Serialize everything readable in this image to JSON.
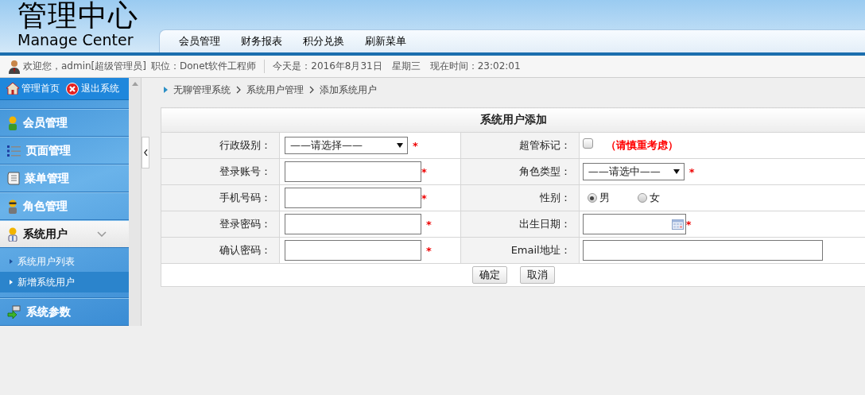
{
  "header": {
    "logo_title": "管理中心",
    "logo_subtitle": "Manage Center",
    "nav": [
      {
        "label": "会员管理"
      },
      {
        "label": "财务报表"
      },
      {
        "label": "积分兑换"
      },
      {
        "label": "刷新菜单"
      }
    ]
  },
  "info_bar": {
    "welcome": "欢迎您，admin[超级管理员]",
    "position": "职位：Donet软件工程师",
    "today": "今天是：2016年8月31日",
    "weekday": "星期三",
    "time": "现在时间：23:02:01"
  },
  "sidebar": {
    "top_links": [
      {
        "label": "管理首页",
        "kind": "home"
      },
      {
        "label": "退出系统",
        "kind": "exit"
      }
    ],
    "items": [
      {
        "label": "会员管理",
        "kind": "member",
        "expanded": false
      },
      {
        "label": "页面管理",
        "kind": "list",
        "expanded": false
      },
      {
        "label": "菜单管理",
        "kind": "doc",
        "expanded": false
      },
      {
        "label": "角色管理",
        "kind": "role",
        "expanded": false
      },
      {
        "label": "系统用户",
        "kind": "user",
        "expanded": true,
        "children": [
          {
            "label": "系统用户列表",
            "selected": false
          },
          {
            "label": "新增系统用户",
            "selected": true
          }
        ]
      },
      {
        "label": "系统参数",
        "kind": "param",
        "expanded": false
      }
    ]
  },
  "breadcrumb": [
    "无聊管理系统",
    "系统用户管理",
    "添加系统用户"
  ],
  "form": {
    "title": "系统用户添加",
    "rows": [
      [
        {
          "label": "行政级别：",
          "kind": "select",
          "value": "——请选择——",
          "mark": "*"
        },
        {
          "label": "超管标记：",
          "kind": "checkbox",
          "checked": false,
          "note": "（请慎重考虑）"
        }
      ],
      [
        {
          "label": "登录账号：",
          "kind": "text",
          "mark": "*"
        },
        {
          "label": "角色类型：",
          "kind": "select",
          "value": "——请选中——",
          "mark": "*"
        }
      ],
      [
        {
          "label": "手机号码：",
          "kind": "text",
          "mark": "*"
        },
        {
          "label": "性别：",
          "kind": "radio",
          "options": [
            {
              "label": "男",
              "selected": true
            },
            {
              "label": "女",
              "selected": false
            }
          ]
        }
      ],
      [
        {
          "label": "登录密码：",
          "kind": "password",
          "mark": "*"
        },
        {
          "label": "出生日期：",
          "kind": "date",
          "mark": "*"
        }
      ],
      [
        {
          "label": "确认密码：",
          "kind": "password",
          "mark": "*"
        },
        {
          "label": "Email地址：",
          "kind": "email"
        }
      ]
    ],
    "buttons": [
      "确定",
      "取消"
    ]
  }
}
